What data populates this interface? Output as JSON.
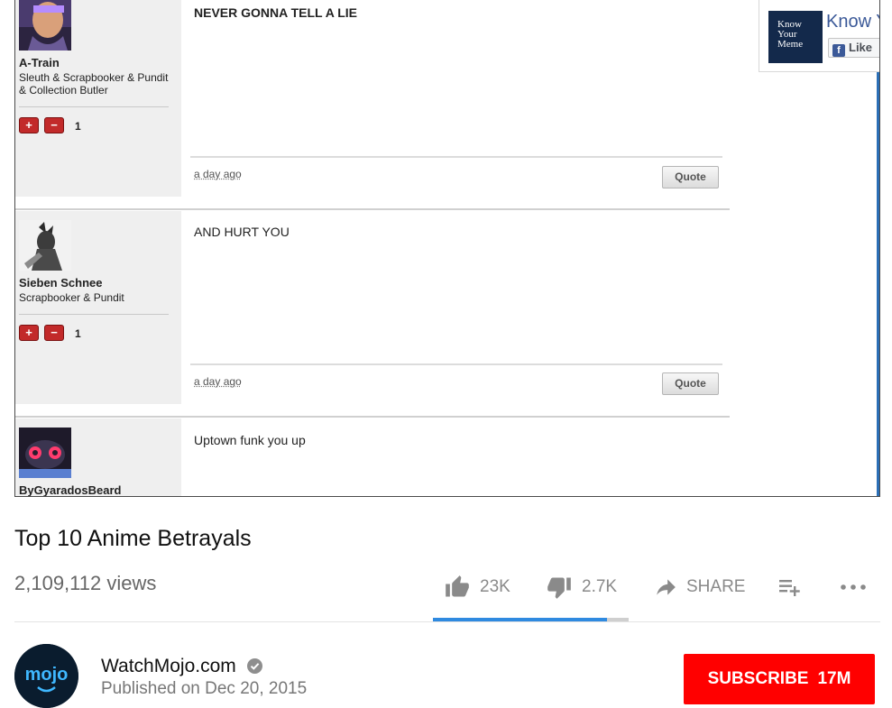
{
  "forum": {
    "posts": [
      {
        "username": "A-Train",
        "user_title": "Sleuth & Scrapbooker & Pundit & Collection Butler",
        "vote_up": "+",
        "vote_down": "−",
        "score": "1",
        "text": "NEVER GONNA TELL A LIE",
        "timestamp": "a day ago",
        "quote_label": "Quote"
      },
      {
        "username": "Sieben Schnee",
        "user_title": "Scrapbooker & Pundit",
        "vote_up": "+",
        "vote_down": "−",
        "score": "1",
        "text": "AND HURT YOU",
        "timestamp": "a day ago",
        "quote_label": "Quote"
      },
      {
        "username": "ByGyaradosBeard",
        "text": "Uptown funk you up"
      }
    ],
    "sidebar_ad": {
      "logo_lines": [
        "Know",
        "Your",
        "Meme"
      ],
      "name": "Know Y",
      "like_label": "Like",
      "fb_glyph": "f"
    }
  },
  "video": {
    "title": "Top 10 Anime Betrayals",
    "views": "2,109,112 views",
    "likes": "23K",
    "dislikes": "2.7K",
    "share_label": "SHARE",
    "like_ratio": 0.89,
    "icons": [
      "thumbs-up-icon",
      "thumbs-down-icon",
      "share-icon",
      "add-to-playlist-icon",
      "more-icon"
    ]
  },
  "channel": {
    "name": "WatchMojo.com",
    "avatar_text": "mojo",
    "published": "Published on Dec 20, 2015",
    "subscribe_label": "SUBSCRIBE",
    "subscriber_count": "17M"
  },
  "colors": {
    "subscribe_red": "#ff0000",
    "like_bar_blue": "#2f8ae0",
    "vote_red": "#c22a2a"
  }
}
